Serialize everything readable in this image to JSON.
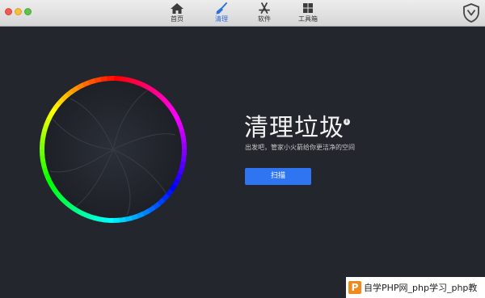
{
  "toolbar": {
    "tabs": [
      {
        "label": "首页",
        "icon": "home-icon"
      },
      {
        "label": "清理",
        "icon": "broom-icon",
        "active": true
      },
      {
        "label": "软件",
        "icon": "app-store-icon"
      },
      {
        "label": "工具箱",
        "icon": "toolbox-icon"
      }
    ],
    "shield_icon": "shield-icon"
  },
  "main": {
    "title": "清理垃圾",
    "info_icon": "i",
    "subtitle": "出发吧，管家小火箭给你更洁净的空间",
    "scan_label": "扫描",
    "accent_color": "#2f74f0"
  },
  "watermark": {
    "logo": "P",
    "text": "自学PHP网_php学习_php教"
  }
}
